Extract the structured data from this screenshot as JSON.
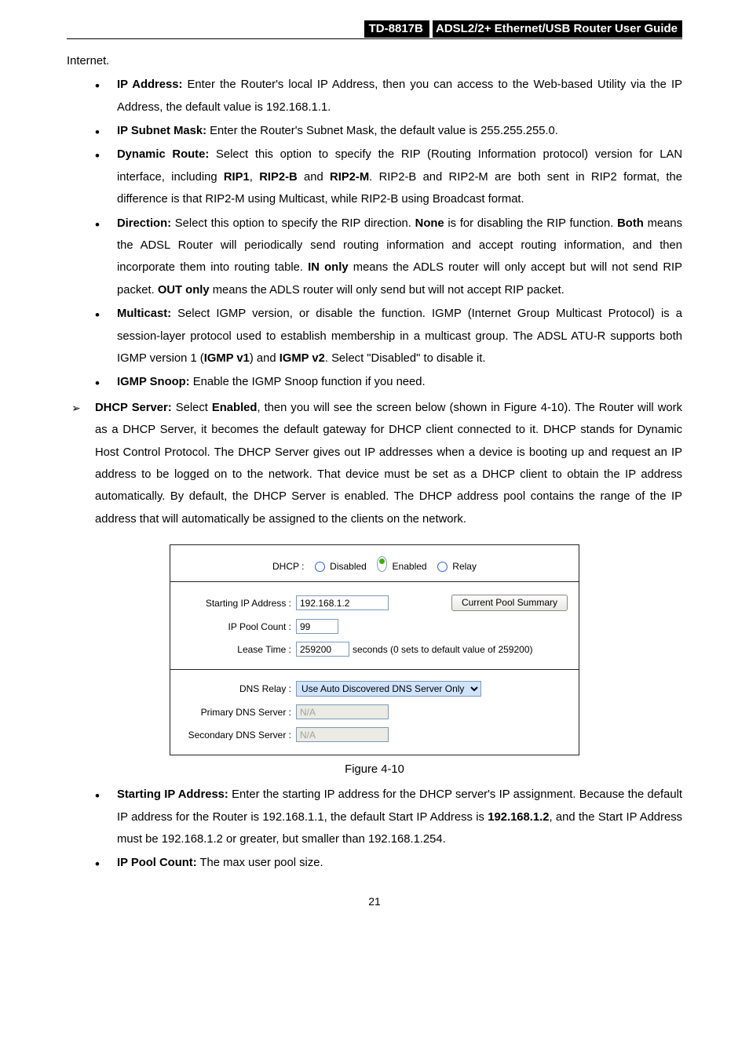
{
  "header": {
    "model": "TD-8817B",
    "title_rest": "ADSL2/2+  Ethernet/USB  Router  User  Guide"
  },
  "intro": "Internet.",
  "bullets1": [
    {
      "bold": "IP Address:",
      "text": " Enter the Router's local IP Address, then you can access to the Web-based Utility via the IP Address, the default value is 192.168.1.1."
    },
    {
      "bold": "IP Subnet Mask:",
      "text": " Enter the Router's Subnet Mask, the default value is 255.255.255.0."
    },
    {
      "bold": "Dynamic Route:",
      "text": " Select this option to specify the RIP (Routing Information protocol) version for LAN interface, including ",
      "b2": "RIP1",
      "t2": ", ",
      "b3": "RIP2-B",
      "t3": " and ",
      "b4": "RIP2-M",
      "t4": ". RIP2-B and RIP2-M are both sent in RIP2 format, the difference is that RIP2-M using Multicast, while RIP2-B using Broadcast format."
    },
    {
      "bold": "Direction:",
      "text": " Select this option to specify the RIP direction. ",
      "b2": "None",
      "t2": " is for disabling the RIP function. ",
      "b3": "Both",
      "t3": " means the ADSL Router will periodically send routing information and accept routing information, and then incorporate them into routing table. ",
      "b4": "IN only",
      "t4": " means the ADLS router will only accept but will not send RIP packet. ",
      "b5": "OUT only",
      "t5": " means the ADLS router will only send but will not accept RIP packet."
    },
    {
      "bold": "Multicast:",
      "text": " Select IGMP version, or disable the function. IGMP (Internet Group Multicast Protocol) is a session-layer protocol used to establish membership in a multicast group. The ADSL ATU-R supports both IGMP version 1 (",
      "b2": "IGMP v1",
      "t2": ") and ",
      "b3": "IGMP v2",
      "t3": ". Select \"Disabled\" to disable it."
    },
    {
      "bold": "IGMP Snoop:",
      "text": " Enable the IGMP Snoop function if you need."
    }
  ],
  "arrow": {
    "bold1": "DHCP Server:",
    "t1": " Select ",
    "bold2": "Enabled",
    "t2": ", then you will see the screen below (shown in Figure 4-10). The Router will work as a DHCP Server, it becomes the default gateway for DHCP client connected to it. DHCP stands for Dynamic Host Control Protocol. The DHCP Server gives out IP addresses when a device is booting up and request an IP address to be logged on to the network. That device must be set as a DHCP client to obtain the IP address automatically. By default, the DHCP Server is enabled. The DHCP address pool contains the range of the IP address that will automatically be assigned to the clients on the network."
  },
  "panel": {
    "dhcp_label": "DHCP : ",
    "opt_disabled": "Disabled",
    "opt_enabled": "Enabled",
    "opt_relay": "Relay",
    "starting_ip_label": "Starting IP Address :",
    "starting_ip_value": "192.168.1.2",
    "pool_summary_btn": "Current Pool Summary",
    "ip_pool_label": "IP Pool Count :",
    "ip_pool_value": "99",
    "lease_label": "Lease Time :",
    "lease_value": "259200",
    "lease_suffix": " seconds   (0 sets to default value of 259200)",
    "dns_relay_label": "DNS Relay :",
    "dns_relay_value": "Use Auto Discovered DNS Server Only",
    "primary_label": "Primary DNS Server  :",
    "primary_value": "N/A",
    "secondary_label": "Secondary DNS Server :",
    "secondary_value": "N/A"
  },
  "fig_caption": "Figure 4-10",
  "bullets2": [
    {
      "bold": "Starting IP Address:",
      "text": " Enter the starting IP address for the DHCP server's IP assignment. Because the default IP address for the Router is 192.168.1.1, the default Start IP Address is ",
      "b2": "192.168.1.2",
      "t2": ", and the Start IP Address must be 192.168.1.2 or greater, but smaller than 192.168.1.254."
    },
    {
      "bold": "IP Pool Count:",
      "text": " The max user pool size."
    }
  ],
  "pagenum": "21"
}
